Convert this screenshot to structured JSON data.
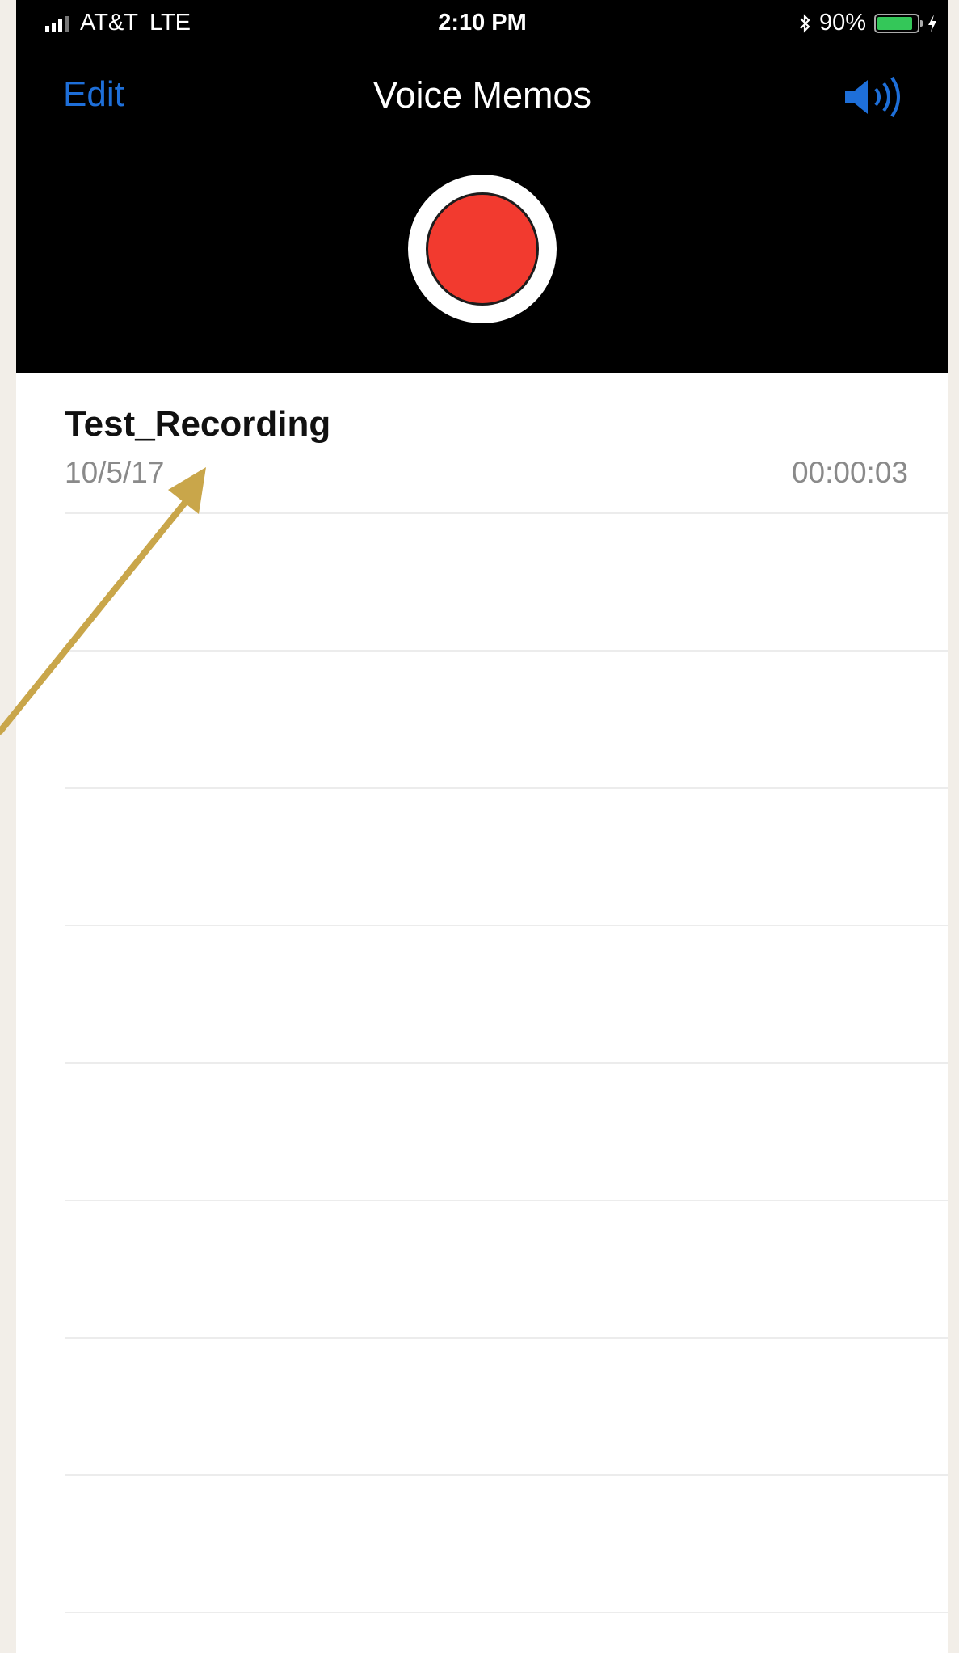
{
  "status_bar": {
    "carrier": "AT&T",
    "network": "LTE",
    "time": "2:10 PM",
    "battery": "90%",
    "battery_level": 0.9,
    "icons": [
      "signal-icon",
      "bluetooth-icon",
      "battery-icon",
      "charging-icon"
    ]
  },
  "nav": {
    "edit_label": "Edit",
    "title": "Voice Memos",
    "speaker_icon": "speaker-icon"
  },
  "record": {
    "icon": "record-icon",
    "color": "#f23a2f"
  },
  "memos": [
    {
      "title": "Test_Recording",
      "date": "10/5/17",
      "duration": "00:00:03"
    }
  ],
  "colors": {
    "accent": "#1e6fd9",
    "annotation_arrow": "#c9a64a",
    "battery": "#34c759"
  }
}
